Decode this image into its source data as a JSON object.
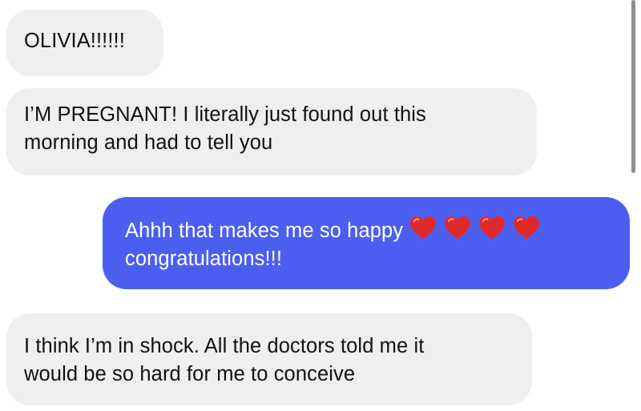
{
  "messages": [
    {
      "direction": "received",
      "lines": [
        "OLIVIA!!!!!!"
      ]
    },
    {
      "direction": "received",
      "lines": [
        "I’M PREGNANT! I literally just found  out this",
        "morning and had to tell you"
      ]
    },
    {
      "direction": "sent",
      "lines": [
        "Ahhh that makes me so happy",
        "congratulations!!!"
      ],
      "emoji": [
        "red-heart-icon",
        "red-heart-icon",
        "red-heart-icon",
        "red-heart-icon"
      ]
    },
    {
      "direction": "received",
      "lines": [
        "I think I’m in shock. All the doctors told me it",
        "would be so hard for me to conceive"
      ]
    }
  ],
  "colors": {
    "received_bubble": "#efeff0",
    "sent_bubble": "#4a5ff0",
    "heart": "#e02a2a",
    "scrollbar": "#8e8e93"
  }
}
